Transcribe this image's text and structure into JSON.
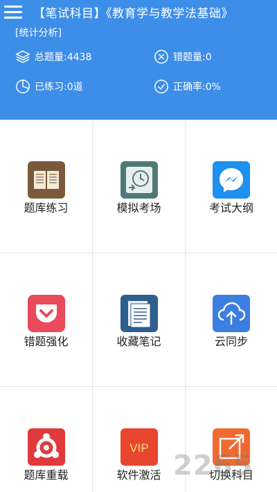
{
  "header": {
    "title": "【笔试科目】《教育学与教学法基础》",
    "section_label": "[统计分析]"
  },
  "stats": {
    "total": "总题量:4438",
    "wrong": "错题量:0",
    "practiced": "已练习:0道",
    "accuracy": "正确率:0%"
  },
  "menu": [
    {
      "label": "题库练习",
      "icon": "book-icon",
      "color": "#7a5a3a"
    },
    {
      "label": "模拟考场",
      "icon": "clock-icon",
      "color": "#4d7a78"
    },
    {
      "label": "考试大纲",
      "icon": "messenger-icon",
      "color": "#1e90f0"
    },
    {
      "label": "错题强化",
      "icon": "pocket-icon",
      "color": "#e94a5c"
    },
    {
      "label": "收藏笔记",
      "icon": "document-icon",
      "color": "#2f5f8f"
    },
    {
      "label": "云同步",
      "icon": "cloud-upload-icon",
      "color": "#3d7fe0"
    },
    {
      "label": "题库重载",
      "icon": "reload-icon",
      "color": "#e03a3a"
    },
    {
      "label": "软件激活",
      "icon": "vip-icon",
      "color": "#e8462e",
      "badge": "VIP"
    },
    {
      "label": "切换科目",
      "icon": "switch-icon",
      "color": "#f06a30"
    }
  ],
  "watermark": "2265"
}
